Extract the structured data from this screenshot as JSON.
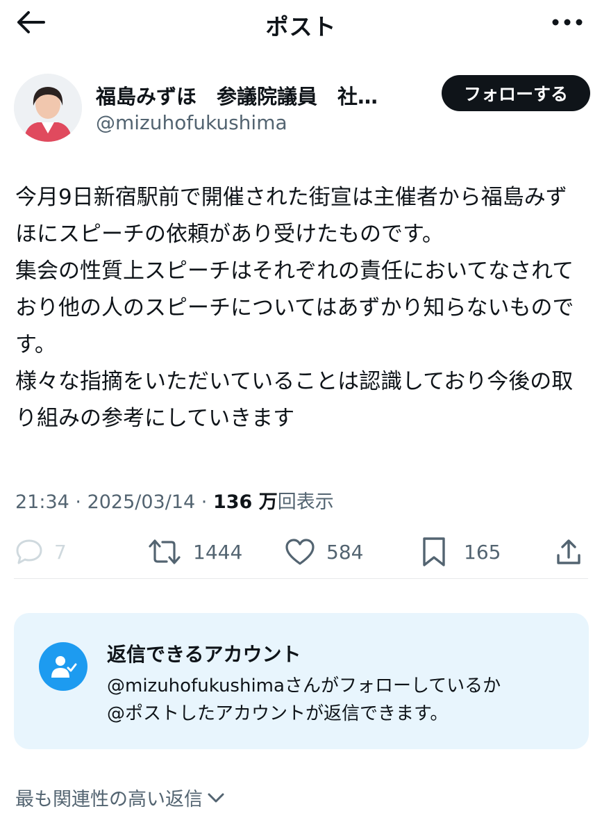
{
  "header": {
    "title": "ポスト",
    "back_icon": "arrow-left-icon",
    "more_icon": "more-horizontal-icon"
  },
  "author": {
    "display_name": "福島みずほ　参議院議員　社…",
    "handle": "@mizuhofukushima",
    "follow_label": "フォローする"
  },
  "tweet": {
    "text": "今月9日新宿駅前で開催された街宣は主催者から福島みずほにスピーチの依頼があり受けたものです。\n集会の性質上スピーチはそれぞれの責任においてなされており他の人のスピーチについてはあずかり知らないものです。\n様々な指摘をいただいていることは認識しており今後の取り組みの参考にしていきます"
  },
  "meta": {
    "time": "21:34",
    "date": "2025/03/14",
    "separator": " · ",
    "views_count": "136 万",
    "views_label": "回表示"
  },
  "actions": {
    "reply_count": "7",
    "retweet_count": "1444",
    "like_count": "584",
    "bookmark_count": "165"
  },
  "reply_restriction": {
    "title": "返信できるアカウント",
    "line1": "@mizuhofukushimaさんがフォローしているか",
    "line2": "@ポストしたアカウントが返信できます。"
  },
  "replies_sort": {
    "label": "最も関連性の高い返信"
  },
  "colors": {
    "text_primary": "#0f1419",
    "text_secondary": "#536471",
    "accent": "#1d9bf0",
    "card_bg": "#e8f5fd"
  }
}
